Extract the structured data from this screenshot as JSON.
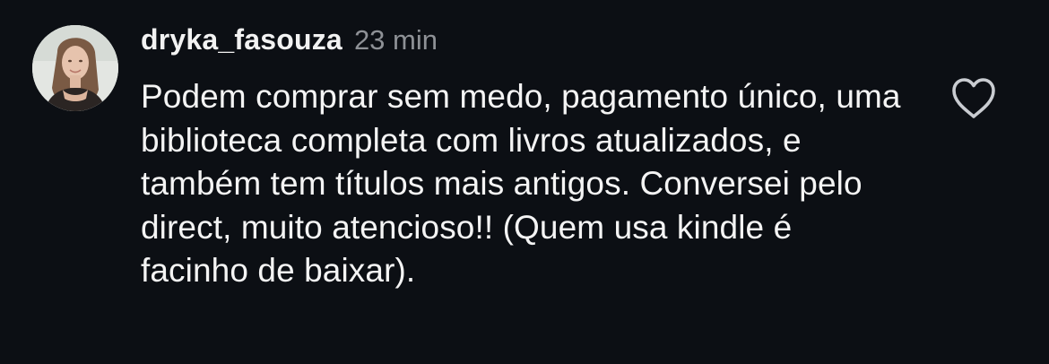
{
  "comment": {
    "username": "dryka_fasouza",
    "timestamp": "23 min",
    "text": "Podem comprar sem medo, pagamento único, uma biblioteca completa com livros atualizados, e também tem títulos mais antigos. Conversei pelo direct, muito atencioso!! (Quem usa kindle é facinho de baixar).",
    "avatar_icon": "profile-photo",
    "like_icon": "heart-outline-icon"
  },
  "colors": {
    "background": "#0c0f14",
    "text": "#f4f4f4",
    "muted": "#8e9196"
  }
}
